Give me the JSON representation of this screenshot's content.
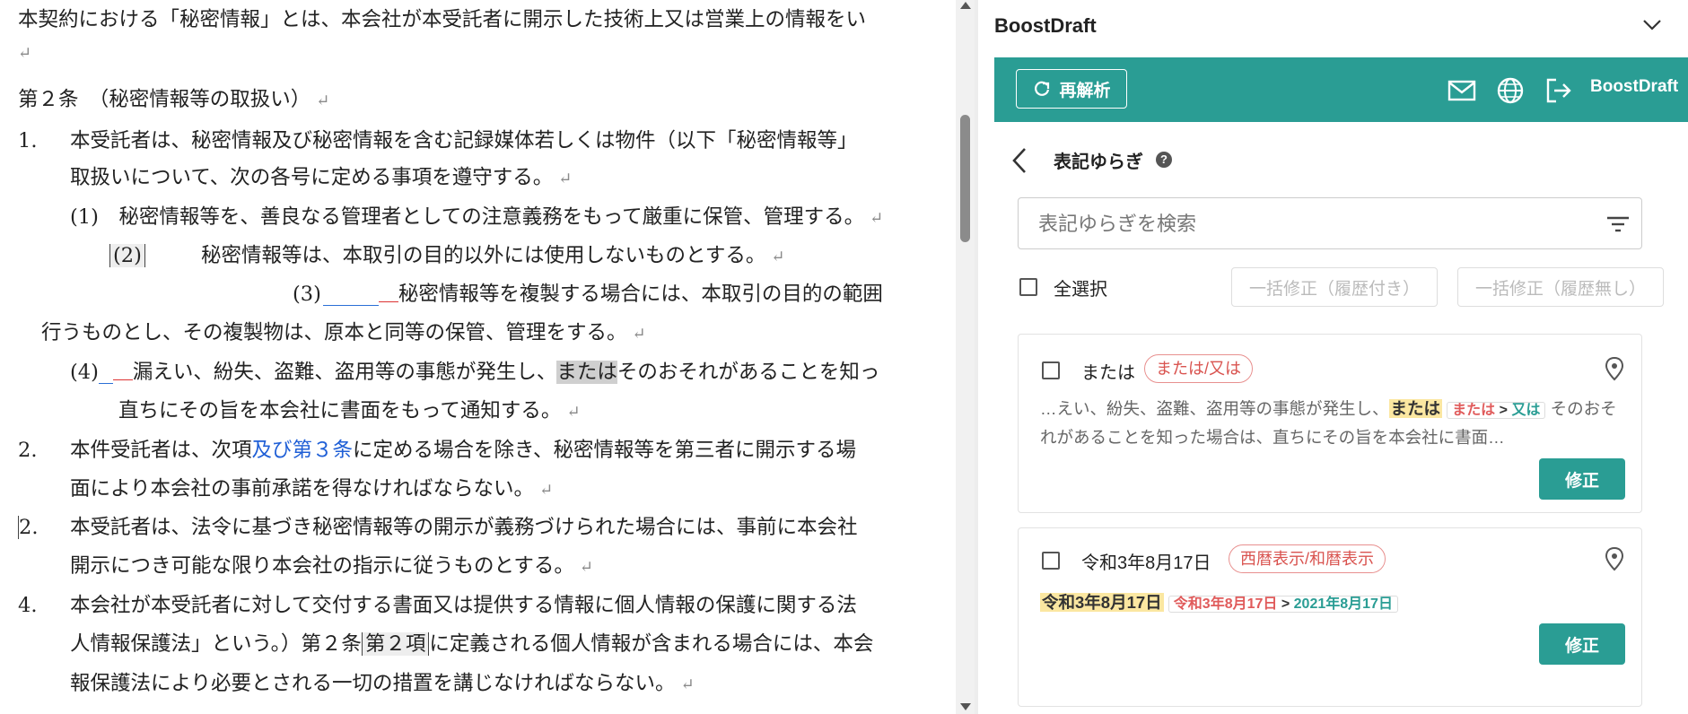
{
  "document": {
    "lines": [
      "本契約における「秘密情報」とは、本会社が本受託者に開示した技術上又は営業上の情報をい",
      "第２条　（秘密情報等の取扱い）",
      "1.",
      "本受託者は、秘密情報及び秘密情報を含む記録媒体若しくは物件（以下「秘密情報等」",
      "取扱いについて、次の各号に定める事項を遵守する。",
      "(1)　秘密情報等を、善良なる管理者としての注意義務をもって厳重に保管、管理する。",
      "(2)",
      "秘密情報等は、本取引の目的以外には使用しないものとする。",
      "(3)",
      "秘密情報等を複製する場合には、本取引の目的の範囲",
      "行うものとし、その複製物は、原本と同等の保管、管理をする。",
      "(4)",
      "漏えい、紛失、盗難、盗用等の事態が発生し、",
      "または",
      "そのおそれがあることを知っ",
      "直ちにその旨を本会社に書面をもって通知する。",
      "2.",
      "本件受託者は、次項",
      "及び第３条",
      "に定める場合を除き、秘密情報等を第三者に開示する場",
      "面により本会社の事前承諾を得なければならない。",
      "2.",
      "本受託者は、法令に基づき秘密情報等の開示が義務づけられた場合には、事前に本会社",
      "開示につき可能な限り本会社の指示に従うものとする。",
      "4.",
      "本会社が本受託者に対して交付する書面又は提供する情報に個人情報の保護に関する法",
      "人情報保護法」という。）第２条",
      "第２項",
      "に定義される個人情報が含まれる場合には、本会",
      "報保護法により必要とされる一切の措置を講じなければならない。"
    ],
    "para_mark": "↵"
  },
  "panel": {
    "title": "BoostDraft",
    "reparse_label": "再解析",
    "brand_label": "BoostDraft",
    "section_title": "表記ゆらぎ",
    "help_label": "?",
    "search_placeholder": "表記ゆらぎを検索",
    "select_all_label": "全選択",
    "bulk_with_history": "一括修正（履歴付き）",
    "bulk_without_history": "一括修正（履歴無し）",
    "cards": [
      {
        "term": "または",
        "tag": "または/又は",
        "context_before": "…えい、紛失、盗難、盗用等の事態が発生し、",
        "highlight": "または",
        "chip_from": "または",
        "chip_arrow": ">",
        "chip_to": "又は",
        "context_after": "そのおそれがあることを知った場合は、直ちにその旨を本会社に書面…",
        "fix_label": "修正"
      },
      {
        "term": "令和3年8月17日",
        "tag": "西暦表示/和暦表示",
        "highlight": "令和3年8月17日",
        "chip_from": "令和3年8月17日",
        "chip_arrow": ">",
        "chip_to": "2021年8月17日",
        "fix_label": "修正"
      }
    ]
  },
  "colors": {
    "accent": "#2a9d94",
    "tag_red": "#d9534f",
    "highlight_yellow": "#fbe7a1",
    "link_blue": "#1f5fd6"
  },
  "icons": [
    "refresh-icon",
    "mail-icon",
    "globe-icon",
    "logout-icon",
    "chevron-down-icon",
    "back-arrow-icon",
    "help-icon",
    "filter-icon",
    "location-pin-icon"
  ]
}
